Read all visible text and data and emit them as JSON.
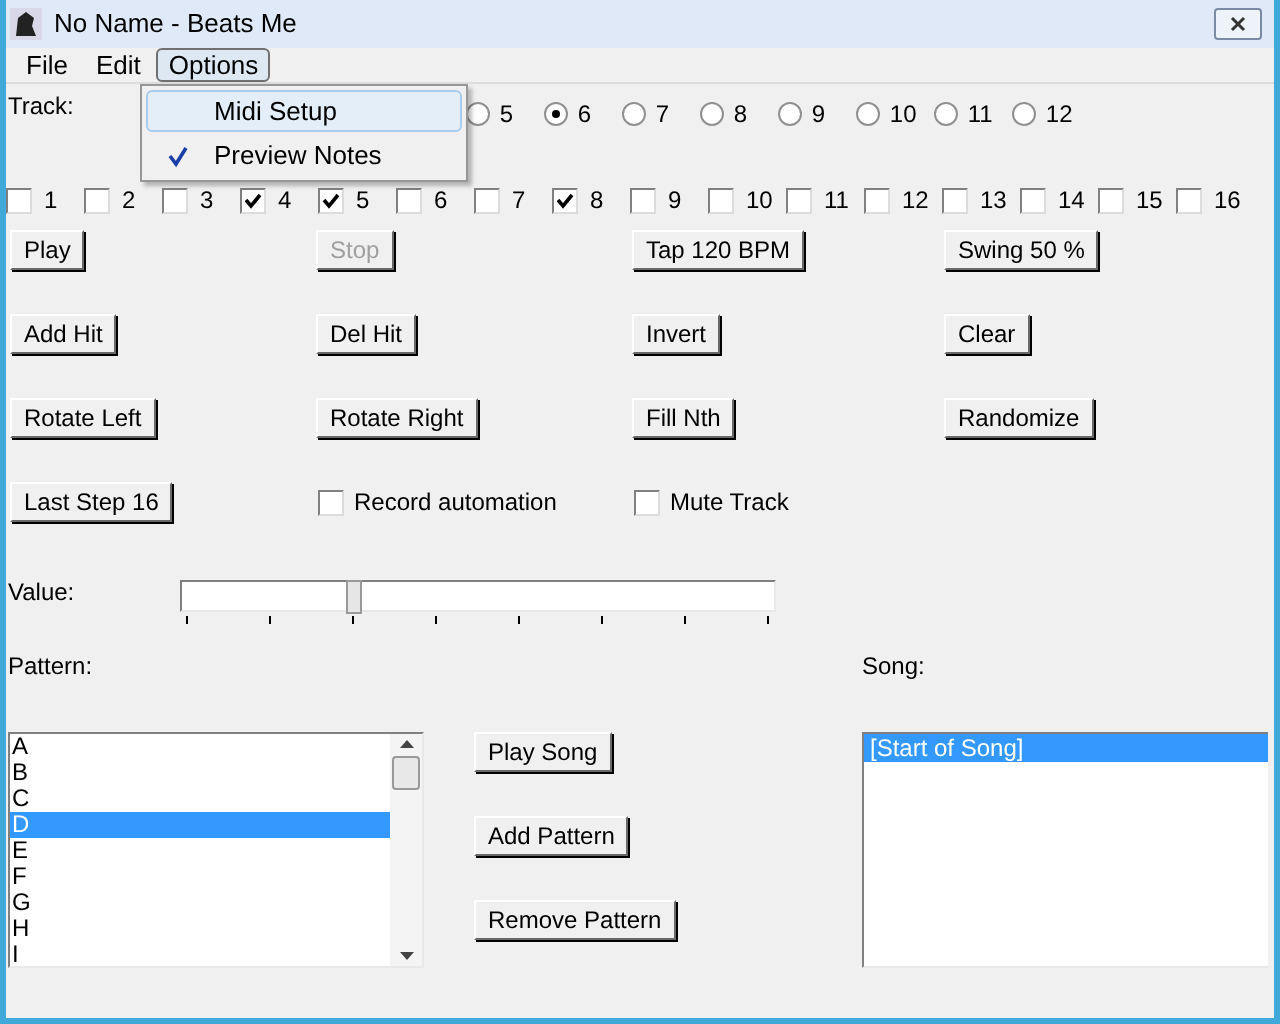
{
  "window": {
    "title": "No Name - Beats Me"
  },
  "menu_bar": [
    {
      "label": "File",
      "selected": false
    },
    {
      "label": "Edit",
      "selected": false
    },
    {
      "label": "Options",
      "selected": true
    }
  ],
  "open_menu": {
    "items": [
      {
        "label": "Midi Setup",
        "checked": false,
        "selected": true
      },
      {
        "label": "Preview Notes",
        "checked": true,
        "selected": false
      }
    ]
  },
  "track": {
    "label": "Track:",
    "options": [
      {
        "label": "5",
        "selected": false
      },
      {
        "label": "6",
        "selected": true
      },
      {
        "label": "7",
        "selected": false
      },
      {
        "label": "8",
        "selected": false
      },
      {
        "label": "9",
        "selected": false
      },
      {
        "label": "10",
        "selected": false
      },
      {
        "label": "11",
        "selected": false
      },
      {
        "label": "12",
        "selected": false
      }
    ]
  },
  "steps": [
    {
      "label": "1",
      "checked": false
    },
    {
      "label": "2",
      "checked": false
    },
    {
      "label": "3",
      "checked": false
    },
    {
      "label": "4",
      "checked": true
    },
    {
      "label": "5",
      "checked": true
    },
    {
      "label": "6",
      "checked": false
    },
    {
      "label": "7",
      "checked": false
    },
    {
      "label": "8",
      "checked": true
    },
    {
      "label": "9",
      "checked": false
    },
    {
      "label": "10",
      "checked": false
    },
    {
      "label": "11",
      "checked": false
    },
    {
      "label": "12",
      "checked": false
    },
    {
      "label": "13",
      "checked": false
    },
    {
      "label": "14",
      "checked": false
    },
    {
      "label": "15",
      "checked": false
    },
    {
      "label": "16",
      "checked": false
    }
  ],
  "button_rows": [
    [
      {
        "kind": "button",
        "label": "Play",
        "disabled": false
      },
      {
        "kind": "button",
        "label": "Stop",
        "disabled": true
      },
      {
        "kind": "button",
        "label": "Tap 120 BPM",
        "disabled": false
      },
      {
        "kind": "button",
        "label": "Swing 50 %",
        "disabled": false
      }
    ],
    [
      {
        "kind": "button",
        "label": "Add Hit",
        "disabled": false
      },
      {
        "kind": "button",
        "label": "Del Hit",
        "disabled": false
      },
      {
        "kind": "button",
        "label": "Invert",
        "disabled": false
      },
      {
        "kind": "button",
        "label": "Clear",
        "disabled": false
      }
    ],
    [
      {
        "kind": "button",
        "label": "Rotate Left",
        "disabled": false
      },
      {
        "kind": "button",
        "label": "Rotate Right",
        "disabled": false
      },
      {
        "kind": "button",
        "label": "Fill Nth",
        "disabled": false
      },
      {
        "kind": "button",
        "label": "Randomize",
        "disabled": false
      }
    ],
    [
      {
        "kind": "button",
        "label": "Last Step 16",
        "disabled": false
      },
      {
        "kind": "checkbox",
        "label": "Record automation",
        "checked": false
      },
      {
        "kind": "checkbox",
        "label": "Mute Track",
        "checked": false
      }
    ]
  ],
  "value": {
    "label": "Value:",
    "level": 0.29
  },
  "pattern": {
    "label": "Pattern:",
    "items": [
      {
        "label": "A",
        "selected": false
      },
      {
        "label": "B",
        "selected": false
      },
      {
        "label": "C",
        "selected": false
      },
      {
        "label": "D",
        "selected": true
      },
      {
        "label": "E",
        "selected": false
      },
      {
        "label": "F",
        "selected": false
      },
      {
        "label": "G",
        "selected": false
      },
      {
        "label": "H",
        "selected": false
      },
      {
        "label": "I",
        "selected": false
      }
    ]
  },
  "song_buttons": [
    {
      "label": "Play Song"
    },
    {
      "label": "Add Pattern"
    },
    {
      "label": "Remove Pattern"
    }
  ],
  "song": {
    "label": "Song:",
    "items": [
      {
        "label": "[Start of Song]",
        "selected": true
      }
    ]
  }
}
